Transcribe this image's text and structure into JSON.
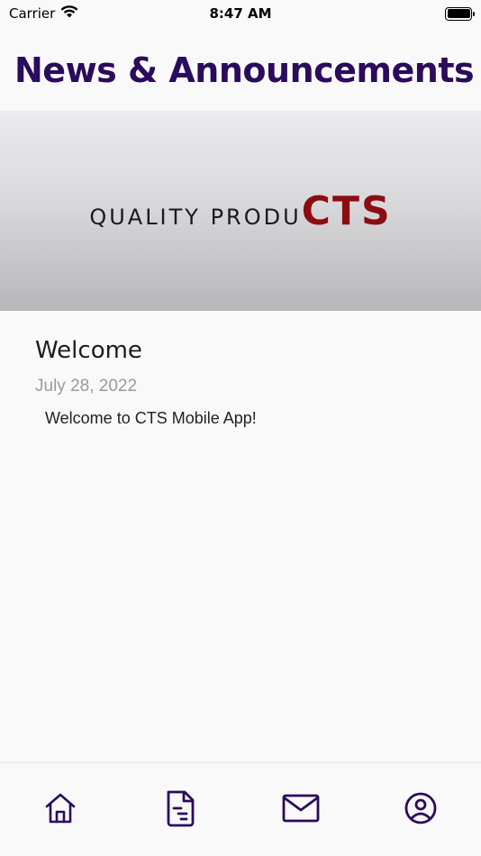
{
  "status_bar": {
    "carrier": "Carrier",
    "time": "8:47 AM",
    "icons": [
      "wifi-icon",
      "battery-icon"
    ]
  },
  "header": {
    "title": "News & Announcements"
  },
  "banner": {
    "logo_text_a": "QUALITY PRODU",
    "logo_text_b": "CTS",
    "colors": {
      "logo_dark": "#1a1a1a",
      "logo_red": "#8b0d12"
    }
  },
  "post": {
    "title": "Welcome",
    "date": "July 28, 2022",
    "body": "Welcome to CTS Mobile App!"
  },
  "tab_bar": {
    "items": [
      {
        "icon": "home-icon"
      },
      {
        "icon": "document-icon"
      },
      {
        "icon": "mail-icon"
      },
      {
        "icon": "profile-icon"
      }
    ],
    "accent": "#2b0b5c"
  }
}
